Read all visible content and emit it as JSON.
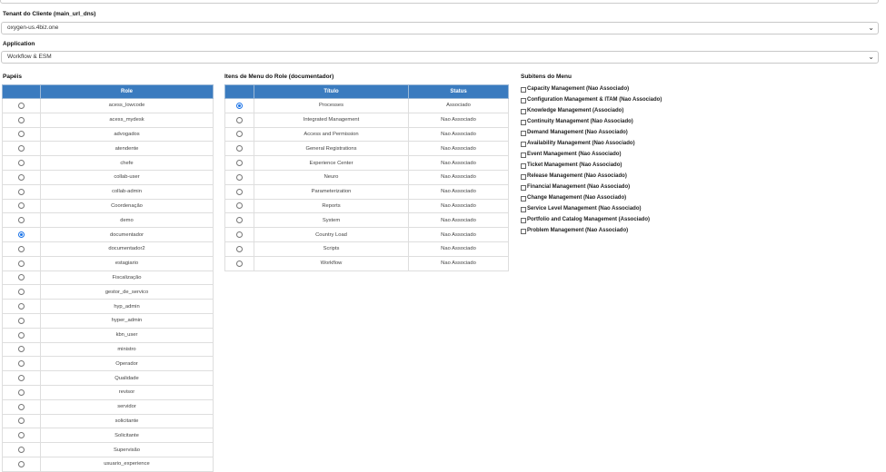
{
  "tenant": {
    "label": "Tenant do Cliente (main_url_dns)",
    "value": "oxygen-us.4biz.one"
  },
  "application": {
    "label": "Application",
    "value": "Workflow & ESM"
  },
  "roles": {
    "title": "Papéis",
    "col_role": "Role",
    "items": [
      {
        "name": "acess_lowcode",
        "selected": false
      },
      {
        "name": "acess_mydesk",
        "selected": false
      },
      {
        "name": "advogados",
        "selected": false
      },
      {
        "name": "atendente",
        "selected": false
      },
      {
        "name": "chefe",
        "selected": false
      },
      {
        "name": "collab-user",
        "selected": false
      },
      {
        "name": "collab-admin",
        "selected": false
      },
      {
        "name": "Coordenação",
        "selected": false
      },
      {
        "name": "demo",
        "selected": false
      },
      {
        "name": "documentador",
        "selected": true
      },
      {
        "name": "documentador2",
        "selected": false
      },
      {
        "name": "estagiario",
        "selected": false
      },
      {
        "name": "Fiscalização",
        "selected": false
      },
      {
        "name": "gestor_de_servico",
        "selected": false
      },
      {
        "name": "hyp_admin",
        "selected": false
      },
      {
        "name": "hyper_admin",
        "selected": false
      },
      {
        "name": "kbn_user",
        "selected": false
      },
      {
        "name": "ministro",
        "selected": false
      },
      {
        "name": "Operador",
        "selected": false
      },
      {
        "name": "Qualidade",
        "selected": false
      },
      {
        "name": "revisor",
        "selected": false
      },
      {
        "name": "servidor",
        "selected": false
      },
      {
        "name": "solicitante",
        "selected": false
      },
      {
        "name": "Solicitante",
        "selected": false
      },
      {
        "name": "Supervisão",
        "selected": false
      },
      {
        "name": "usuario_experience",
        "selected": false
      }
    ]
  },
  "menu_items": {
    "title": "Itens de Menu do Role (documentador)",
    "col_title": "Título",
    "col_status": "Status",
    "items": [
      {
        "title": "Processes",
        "status": "Associado",
        "selected": true
      },
      {
        "title": "Integrated Management",
        "status": "Nao Associado",
        "selected": false
      },
      {
        "title": "Access and Permission",
        "status": "Nao Associado",
        "selected": false
      },
      {
        "title": "General Registrations",
        "status": "Nao Associado",
        "selected": false
      },
      {
        "title": "Experience Center",
        "status": "Nao Associado",
        "selected": false
      },
      {
        "title": "Neuro",
        "status": "Nao Associado",
        "selected": false
      },
      {
        "title": "Parameterization",
        "status": "Nao Associado",
        "selected": false
      },
      {
        "title": "Reports",
        "status": "Nao Associado",
        "selected": false
      },
      {
        "title": "System",
        "status": "Nao Associado",
        "selected": false
      },
      {
        "title": "Country Load",
        "status": "Nao Associado",
        "selected": false
      },
      {
        "title": "Scripts",
        "status": "Nao Associado",
        "selected": false
      },
      {
        "title": "Workflow",
        "status": "Nao Associado",
        "selected": false
      }
    ]
  },
  "subitems": {
    "title": "Subitens do Menu",
    "items": [
      "Capacity Management (Nao Associado)",
      "Configuration Management & ITAM (Nao Associado)",
      "Knowledge Management (Associado)",
      "Continuity Management (Nao Associado)",
      "Demand Management (Nao Associado)",
      "Availability Management (Nao Associado)",
      "Event Management (Nao Associado)",
      "Ticket Management (Nao Associado)",
      "Release Management (Nao Associado)",
      "Financial Management (Nao Associado)",
      "Change Management (Nao Associado)",
      "Service Level Management (Nao Associado)",
      "Portfolio and Catalog Management (Associado)",
      "Problem Management (Nao Associado)"
    ]
  }
}
